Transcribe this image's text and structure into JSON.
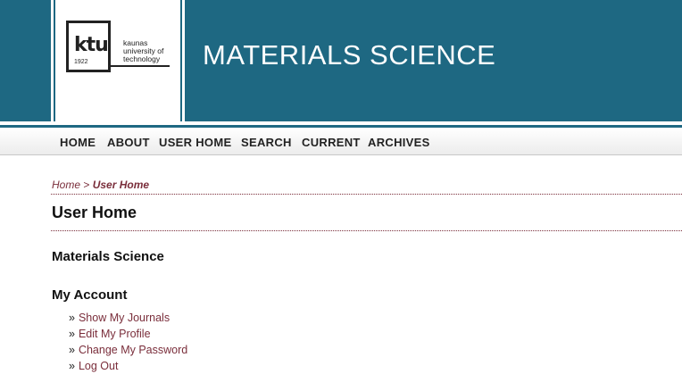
{
  "header": {
    "logo": {
      "mark": "ktu",
      "year": "1922",
      "text_lines": [
        "kaunas",
        "university of",
        "technology"
      ]
    },
    "site_title": "MATERIALS SCIENCE",
    "colors": {
      "header_bg": "#1e6882",
      "link": "#7a2e3b"
    }
  },
  "nav": {
    "items": [
      "HOME",
      "ABOUT",
      "USER HOME",
      "SEARCH",
      "CURRENT",
      "ARCHIVES"
    ]
  },
  "breadcrumb": {
    "home": "Home",
    "separator": ">",
    "current": "User Home"
  },
  "main": {
    "page_title": "User Home",
    "journal_title": "Materials Science",
    "account": {
      "title": "My Account",
      "bullet": "»",
      "links": [
        "Show My Journals",
        "Edit My Profile",
        "Change My Password",
        "Log Out"
      ]
    }
  }
}
